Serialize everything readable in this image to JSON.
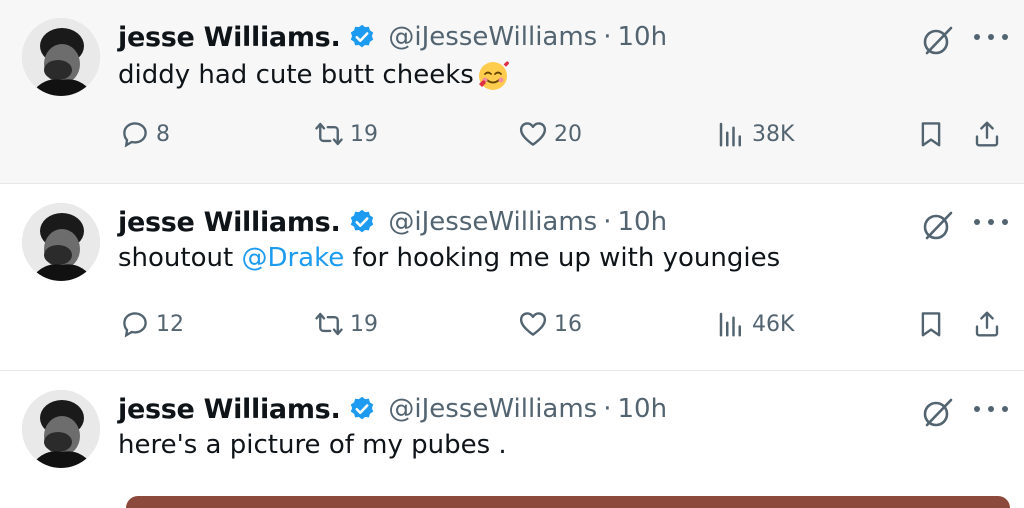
{
  "tweets": [
    {
      "name": "jesse Williams.",
      "handle": "@iJesseWilliams",
      "dot": "·",
      "time": "10h",
      "text_plain": "diddy had cute butt cheeks",
      "emoji": "smiling-face-with-hearts",
      "replies": "8",
      "retweets": "19",
      "likes": "20",
      "views": "38K"
    },
    {
      "name": "jesse Williams.",
      "handle": "@iJesseWilliams",
      "dot": "·",
      "time": "10h",
      "text_before": "shoutout",
      "mention": "@Drake",
      "text_after": "for hooking me up with youngies",
      "replies": "12",
      "retweets": "19",
      "likes": "16",
      "views": "46K"
    },
    {
      "name": "jesse Williams.",
      "handle": "@iJesseWilliams",
      "dot": "·",
      "time": "10h",
      "text_plain": "here's a picture of my pubes ."
    }
  ],
  "colors": {
    "accent": "#1d9bf0",
    "muted": "#536471",
    "verified": "#1d9bf0",
    "highlight_bg": "#f7f7f7"
  },
  "icons": [
    "reply-icon",
    "retweet-icon",
    "like-icon",
    "views-icon",
    "bookmark-icon",
    "share-icon",
    "grok-icon",
    "more-icon",
    "verified-badge-icon"
  ]
}
